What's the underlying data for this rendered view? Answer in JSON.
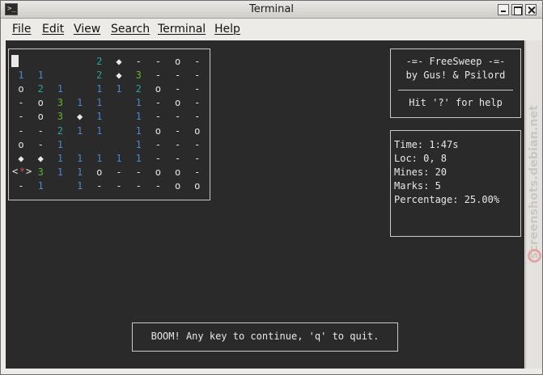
{
  "window": {
    "title": "Terminal"
  },
  "menubar": {
    "items": [
      "File",
      "Edit",
      "View",
      "Search",
      "Terminal",
      "Help"
    ]
  },
  "game": {
    "name": "FreeSweep",
    "title_line": "-=- FreeSweep -=-",
    "authors_line": "by Gus! & Psilord",
    "help_line": "Hit '?' for help",
    "stats": {
      "time": "Time: 1:47s",
      "loc": "Loc: 0, 8",
      "mines": "Mines: 20",
      "marks": "Marks: 5",
      "percentage": "Percentage: 25.00%"
    },
    "message": "BOOM! Any key to continue, 'q' to quit.",
    "cursor_marker": {
      "left": "<",
      "mine": "*",
      "right": ">"
    },
    "board": [
      [
        "",
        "",
        "",
        "",
        "2",
        "◆",
        "-",
        "-",
        "o",
        "-"
      ],
      [
        "1",
        "1",
        "",
        "",
        "2",
        "◆",
        "3",
        "-",
        "-",
        "-"
      ],
      [
        "o",
        "2",
        "1",
        "",
        "1",
        "1",
        "2",
        "o",
        "-",
        "-"
      ],
      [
        "-",
        "o",
        "3",
        "1",
        "1",
        "",
        "1",
        "-",
        "o",
        "-"
      ],
      [
        "-",
        "o",
        "3",
        "◆",
        "1",
        "",
        "1",
        "-",
        "-",
        "-"
      ],
      [
        "-",
        "-",
        "2",
        "1",
        "1",
        "",
        "1",
        "o",
        "-",
        "o"
      ],
      [
        "o",
        "-",
        "1",
        "",
        "",
        "",
        "1",
        "-",
        "-",
        "-"
      ],
      [
        "◆",
        "◆",
        "1",
        "1",
        "1",
        "1",
        "1",
        "-",
        "-",
        "-"
      ],
      [
        "",
        "3",
        "1",
        "1",
        "o",
        "-",
        "-",
        "o",
        "o",
        "-"
      ],
      [
        "-",
        "1",
        "",
        "1",
        "-",
        "-",
        "-",
        "-",
        "o",
        "o"
      ]
    ]
  },
  "watermark": {
    "text": "screenshots.debian.net"
  },
  "colors": {
    "one": "#4a86c8",
    "two": "#2aa198",
    "three": "#5cb82e",
    "mine": "#d94848",
    "terminal_bg": "#2a2a2a"
  }
}
